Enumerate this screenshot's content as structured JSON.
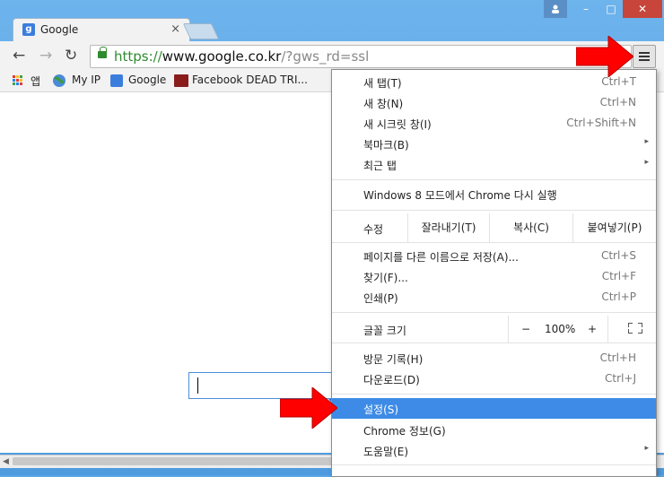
{
  "window": {
    "minimize_glyph": "–",
    "maximize_glyph": "□",
    "close_glyph": "✕"
  },
  "tab": {
    "favicon_letter": "g",
    "title": "Google",
    "close_glyph": "×"
  },
  "toolbar": {
    "back_glyph": "←",
    "forward_glyph": "→",
    "reload_glyph": "↻",
    "url_scheme": "https://",
    "url_host": "www.google.co.kr",
    "url_path": "/?gws_rd=ssl",
    "star_glyph": "☆"
  },
  "bookmarks": [
    {
      "label": "앱",
      "icon": "apps-grid-icon"
    },
    {
      "label": "My IP",
      "icon": "globe-icon"
    },
    {
      "label": "Google",
      "icon": "google-favicon-icon"
    },
    {
      "label": "Facebook DEAD TRI...",
      "icon": "facebook-dead-trigger-icon"
    }
  ],
  "menu": {
    "new_tab": {
      "label": "새 탭(T)",
      "shortcut": "Ctrl+T"
    },
    "new_window": {
      "label": "새 창(N)",
      "shortcut": "Ctrl+N"
    },
    "incognito": {
      "label": "새 시크릿 창(I)",
      "shortcut": "Ctrl+Shift+N"
    },
    "bookmarks": {
      "label": "북마크(B)"
    },
    "recent_tabs": {
      "label": "최근 탭"
    },
    "relaunch_win8": {
      "label": "Windows 8 모드에서 Chrome 다시 실행"
    },
    "edit": {
      "label": "수정",
      "cut": "잘라내기(T)",
      "copy": "복사(C)",
      "paste": "붙여넣기(P)"
    },
    "save_page": {
      "label": "페이지를 다른 이름으로 저장(A)...",
      "shortcut": "Ctrl+S"
    },
    "find": {
      "label": "찾기(F)...",
      "shortcut": "Ctrl+F"
    },
    "print": {
      "label": "인쇄(P)",
      "shortcut": "Ctrl+P"
    },
    "zoom": {
      "label": "글꼴 크기",
      "minus": "−",
      "value": "100%",
      "plus": "+"
    },
    "history": {
      "label": "방문 기록(H)",
      "shortcut": "Ctrl+H"
    },
    "downloads": {
      "label": "다운로드(D)",
      "shortcut": "Ctrl+J"
    },
    "settings": {
      "label": "설정(S)"
    },
    "about": {
      "label": "Chrome 정보(G)"
    },
    "help": {
      "label": "도움말(E)"
    },
    "submenu_glyph": "▸"
  },
  "colors": {
    "menu_highlight": "#3d8be6",
    "arrow_red": "#ff0000",
    "url_green": "#2e8b2e"
  }
}
